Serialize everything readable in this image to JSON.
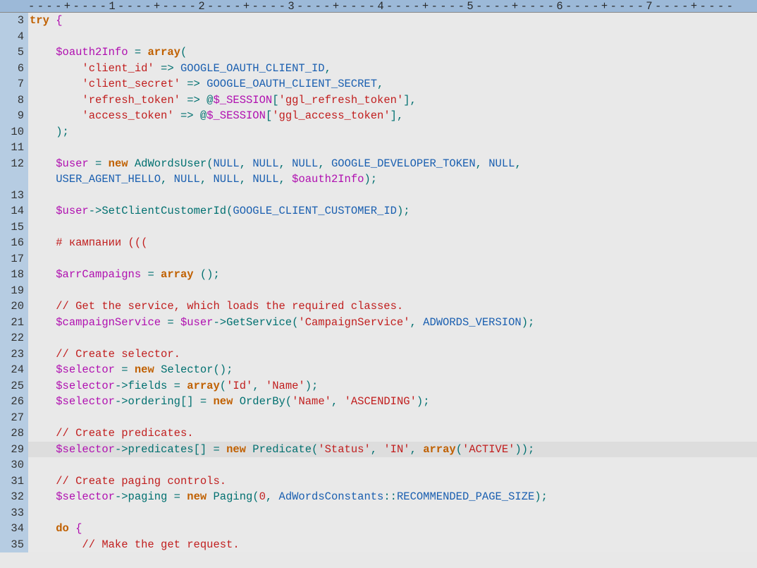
{
  "ruler": "----+----1----+----2----+----3----+----4----+----5----+----6----+----7----+----",
  "lines": [
    {
      "num": 3,
      "tokens": [
        [
          "keyword",
          "try"
        ],
        [
          "op",
          " "
        ],
        [
          "brace",
          "{"
        ]
      ]
    },
    {
      "num": 4,
      "tokens": []
    },
    {
      "num": 5,
      "tokens": [
        [
          "plain",
          "    "
        ],
        [
          "var",
          "$oauth2Info"
        ],
        [
          "op",
          " = "
        ],
        [
          "keyword",
          "array"
        ],
        [
          "paren",
          "("
        ]
      ]
    },
    {
      "num": 6,
      "tokens": [
        [
          "plain",
          "        "
        ],
        [
          "string",
          "'client_id'"
        ],
        [
          "op",
          " => "
        ],
        [
          "const",
          "GOOGLE_OAUTH_CLIENT_ID"
        ],
        [
          "op",
          ","
        ]
      ]
    },
    {
      "num": 7,
      "tokens": [
        [
          "plain",
          "        "
        ],
        [
          "string",
          "'client_secret'"
        ],
        [
          "op",
          " => "
        ],
        [
          "const",
          "GOOGLE_OAUTH_CLIENT_SECRET"
        ],
        [
          "op",
          ","
        ]
      ]
    },
    {
      "num": 8,
      "tokens": [
        [
          "plain",
          "        "
        ],
        [
          "string",
          "'refresh_token'"
        ],
        [
          "op",
          " => "
        ],
        [
          "atsilence",
          "@"
        ],
        [
          "var",
          "$_SESSION"
        ],
        [
          "op",
          "["
        ],
        [
          "string",
          "'ggl_refresh_token'"
        ],
        [
          "op",
          "],"
        ]
      ]
    },
    {
      "num": 9,
      "tokens": [
        [
          "plain",
          "        "
        ],
        [
          "string",
          "'access_token'"
        ],
        [
          "op",
          " => "
        ],
        [
          "atsilence",
          "@"
        ],
        [
          "var",
          "$_SESSION"
        ],
        [
          "op",
          "["
        ],
        [
          "string",
          "'ggl_access_token'"
        ],
        [
          "op",
          "],"
        ]
      ]
    },
    {
      "num": 10,
      "tokens": [
        [
          "plain",
          "    "
        ],
        [
          "paren",
          ")"
        ],
        [
          "semi",
          ";"
        ]
      ]
    },
    {
      "num": 11,
      "tokens": []
    },
    {
      "num": 12,
      "tokens": [
        [
          "plain",
          "    "
        ],
        [
          "var",
          "$user"
        ],
        [
          "op",
          " = "
        ],
        [
          "keyword",
          "new"
        ],
        [
          "plain",
          " "
        ],
        [
          "type",
          "AdWordsUser"
        ],
        [
          "paren",
          "("
        ],
        [
          "const",
          "NULL"
        ],
        [
          "op",
          ", "
        ],
        [
          "const",
          "NULL"
        ],
        [
          "op",
          ", "
        ],
        [
          "const",
          "NULL"
        ],
        [
          "op",
          ", "
        ],
        [
          "const",
          "GOOGLE_DEVELOPER_TOKEN"
        ],
        [
          "op",
          ", "
        ],
        [
          "const",
          "NULL"
        ],
        [
          "op",
          ", "
        ]
      ]
    },
    {
      "num": 12,
      "cont": true,
      "tokens": [
        [
          "plain",
          "    "
        ],
        [
          "const",
          "USER_AGENT_HELLO"
        ],
        [
          "op",
          ", "
        ],
        [
          "const",
          "NULL"
        ],
        [
          "op",
          ", "
        ],
        [
          "const",
          "NULL"
        ],
        [
          "op",
          ", "
        ],
        [
          "const",
          "NULL"
        ],
        [
          "op",
          ", "
        ],
        [
          "var",
          "$oauth2Info"
        ],
        [
          "paren",
          ")"
        ],
        [
          "semi",
          ";"
        ]
      ]
    },
    {
      "num": 13,
      "tokens": []
    },
    {
      "num": 14,
      "tokens": [
        [
          "plain",
          "    "
        ],
        [
          "var",
          "$user"
        ],
        [
          "op",
          "->"
        ],
        [
          "func",
          "SetClientCustomerId"
        ],
        [
          "paren",
          "("
        ],
        [
          "const",
          "GOOGLE_CLIENT_CUSTOMER_ID"
        ],
        [
          "paren",
          ")"
        ],
        [
          "semi",
          ";"
        ]
      ]
    },
    {
      "num": 15,
      "tokens": []
    },
    {
      "num": 16,
      "tokens": [
        [
          "plain",
          "    "
        ],
        [
          "comment",
          "# кампании ((("
        ]
      ]
    },
    {
      "num": 17,
      "tokens": []
    },
    {
      "num": 18,
      "tokens": [
        [
          "plain",
          "    "
        ],
        [
          "var",
          "$arrCampaigns"
        ],
        [
          "op",
          " = "
        ],
        [
          "keyword",
          "array"
        ],
        [
          "plain",
          " "
        ],
        [
          "paren",
          "()"
        ],
        [
          "semi",
          ";"
        ]
      ]
    },
    {
      "num": 19,
      "tokens": []
    },
    {
      "num": 20,
      "tokens": [
        [
          "plain",
          "    "
        ],
        [
          "comment",
          "// Get the service, which loads the required classes."
        ]
      ]
    },
    {
      "num": 21,
      "tokens": [
        [
          "plain",
          "    "
        ],
        [
          "var",
          "$campaignService"
        ],
        [
          "op",
          " = "
        ],
        [
          "var",
          "$user"
        ],
        [
          "op",
          "->"
        ],
        [
          "func",
          "GetService"
        ],
        [
          "paren",
          "("
        ],
        [
          "string",
          "'CampaignService'"
        ],
        [
          "op",
          ", "
        ],
        [
          "const",
          "ADWORDS_VERSION"
        ],
        [
          "paren",
          ")"
        ],
        [
          "semi",
          ";"
        ]
      ]
    },
    {
      "num": 22,
      "tokens": []
    },
    {
      "num": 23,
      "tokens": [
        [
          "plain",
          "    "
        ],
        [
          "comment",
          "// Create selector."
        ]
      ]
    },
    {
      "num": 24,
      "tokens": [
        [
          "plain",
          "    "
        ],
        [
          "var",
          "$selector"
        ],
        [
          "op",
          " = "
        ],
        [
          "keyword",
          "new"
        ],
        [
          "plain",
          " "
        ],
        [
          "type",
          "Selector"
        ],
        [
          "paren",
          "()"
        ],
        [
          "semi",
          ";"
        ]
      ]
    },
    {
      "num": 25,
      "tokens": [
        [
          "plain",
          "    "
        ],
        [
          "var",
          "$selector"
        ],
        [
          "op",
          "->"
        ],
        [
          "func",
          "fields"
        ],
        [
          "op",
          " = "
        ],
        [
          "keyword",
          "array"
        ],
        [
          "paren",
          "("
        ],
        [
          "string",
          "'Id'"
        ],
        [
          "op",
          ", "
        ],
        [
          "string",
          "'Name'"
        ],
        [
          "paren",
          ")"
        ],
        [
          "semi",
          ";"
        ]
      ]
    },
    {
      "num": 26,
      "tokens": [
        [
          "plain",
          "    "
        ],
        [
          "var",
          "$selector"
        ],
        [
          "op",
          "->"
        ],
        [
          "func",
          "ordering"
        ],
        [
          "op",
          "[] = "
        ],
        [
          "keyword",
          "new"
        ],
        [
          "plain",
          " "
        ],
        [
          "type",
          "OrderBy"
        ],
        [
          "paren",
          "("
        ],
        [
          "string",
          "'Name'"
        ],
        [
          "op",
          ", "
        ],
        [
          "string",
          "'ASCENDING'"
        ],
        [
          "paren",
          ")"
        ],
        [
          "semi",
          ";"
        ]
      ]
    },
    {
      "num": 27,
      "tokens": []
    },
    {
      "num": 28,
      "tokens": [
        [
          "plain",
          "    "
        ],
        [
          "comment",
          "// Create predicates."
        ]
      ]
    },
    {
      "num": 29,
      "highlighted": true,
      "tokens": [
        [
          "plain",
          "    "
        ],
        [
          "var",
          "$selector"
        ],
        [
          "op",
          "->"
        ],
        [
          "func",
          "predicates"
        ],
        [
          "op",
          "[] = "
        ],
        [
          "keyword",
          "new"
        ],
        [
          "plain",
          " "
        ],
        [
          "type",
          "Predicate"
        ],
        [
          "paren",
          "("
        ],
        [
          "string",
          "'Status'"
        ],
        [
          "op",
          ", "
        ],
        [
          "string",
          "'IN'"
        ],
        [
          "op",
          ", "
        ],
        [
          "keyword",
          "array"
        ],
        [
          "paren",
          "("
        ],
        [
          "string",
          "'ACTIVE'"
        ],
        [
          "paren",
          "))"
        ],
        [
          "semi",
          ";"
        ]
      ]
    },
    {
      "num": 30,
      "tokens": []
    },
    {
      "num": 31,
      "tokens": [
        [
          "plain",
          "    "
        ],
        [
          "comment",
          "// Create paging controls."
        ]
      ]
    },
    {
      "num": 32,
      "tokens": [
        [
          "plain",
          "    "
        ],
        [
          "var",
          "$selector"
        ],
        [
          "op",
          "->"
        ],
        [
          "func",
          "paging"
        ],
        [
          "op",
          " = "
        ],
        [
          "keyword",
          "new"
        ],
        [
          "plain",
          " "
        ],
        [
          "type",
          "Paging"
        ],
        [
          "paren",
          "("
        ],
        [
          "number",
          "0"
        ],
        [
          "op",
          ", "
        ],
        [
          "const",
          "AdWordsConstants"
        ],
        [
          "op",
          "::"
        ],
        [
          "const",
          "RECOMMENDED_PAGE_SIZE"
        ],
        [
          "paren",
          ")"
        ],
        [
          "semi",
          ";"
        ]
      ]
    },
    {
      "num": 33,
      "tokens": []
    },
    {
      "num": 34,
      "tokens": [
        [
          "plain",
          "    "
        ],
        [
          "keyword",
          "do"
        ],
        [
          "op",
          " "
        ],
        [
          "brace",
          "{"
        ]
      ]
    },
    {
      "num": 35,
      "tokens": [
        [
          "plain",
          "        "
        ],
        [
          "comment",
          "// Make the get request."
        ]
      ]
    }
  ]
}
